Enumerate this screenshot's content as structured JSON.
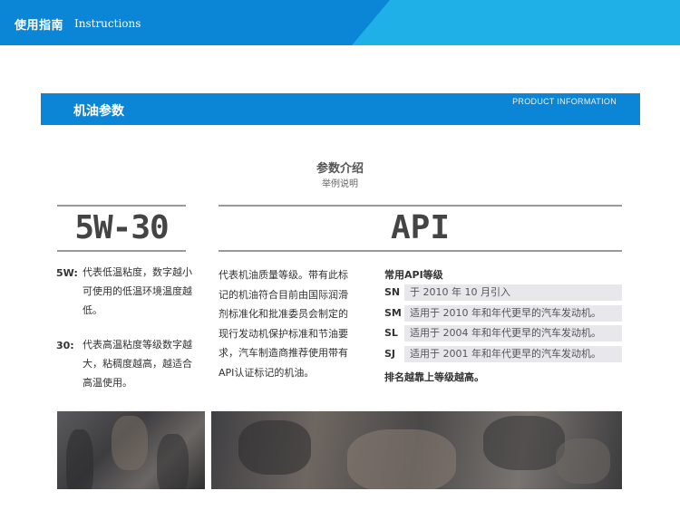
{
  "banner": {
    "title": "使用指南",
    "subtitle": "Instructions"
  },
  "section": {
    "title": "机油参数",
    "subtitle_en": "PRODUCT INFORMATION"
  },
  "intro": {
    "heading": "参数介绍",
    "subheading": "举例说明"
  },
  "viscosity": {
    "label": "5W-30",
    "items": [
      {
        "term": "5W:",
        "desc": "代表低温粘度，数字越小可使用的低温环境温度越低。"
      },
      {
        "term": "30:",
        "desc": "代表高温粘度等级数字越大，粘稠度越高，越适合高温使用。"
      }
    ]
  },
  "api": {
    "label": "API",
    "desc": "代表机油质量等级。带有此标记的机油符合目前由国际润滑剂标准化和批准委员会制定的现行发动机保护标准和节油要求，汽车制造商推荐使用带有API认证标记的机油。",
    "grades_title": "常用API等级",
    "grades": [
      {
        "code": "SN",
        "text": "于 2010 年 10 月引入"
      },
      {
        "code": "SM",
        "text": "适用于 2010 年和年代更早的汽车发动机。"
      },
      {
        "code": "SL",
        "text": "适用于 2004 年和年代更早的汽车发动机。"
      },
      {
        "code": "SJ",
        "text": "适用于 2001 年和年代更早的汽车发动机。"
      }
    ],
    "note": "排名越靠上等级越高。"
  },
  "colors": {
    "brand_blue": "#0b86d6",
    "accent_cyan": "#15b8ec",
    "grade_bg": "#e8e8ec"
  }
}
